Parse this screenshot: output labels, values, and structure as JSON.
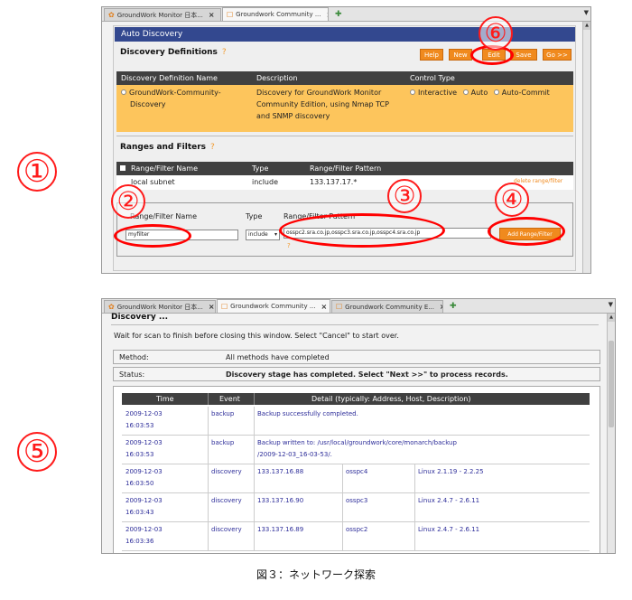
{
  "left_markers": [
    "①",
    "⑤"
  ],
  "shot1": {
    "tabs": [
      {
        "label": "GroundWork Monitor 日本...",
        "close": "×"
      },
      {
        "label": "Groundwork Community ...",
        "close": "×"
      }
    ],
    "new_tab": "✚",
    "tab_menu": "▼",
    "app_title": "Auto Discovery",
    "definitions": {
      "title": "Discovery Definitions",
      "help_mark": "?",
      "buttons": {
        "help": "Help",
        "new": "New",
        "edit": "Edit",
        "save": "Save",
        "go": "Go >>"
      },
      "headers": {
        "name": "Discovery Definition Name",
        "description": "Description",
        "control": "Control Type"
      },
      "row": {
        "name_line1": "GroundWork-Community-",
        "name_line2": "Discovery",
        "desc_line1": "Discovery for GroundWork Monitor",
        "desc_line2": "Community Edition, using Nmap TCP",
        "desc_line3": "and SNMP discovery",
        "control_options": [
          "Interactive",
          "Auto",
          "Auto-Commit"
        ]
      }
    },
    "ranges": {
      "title": "Ranges and Filters",
      "help_mark": "?",
      "headers": {
        "name": "Range/Filter Name",
        "type": "Type",
        "pattern": "Range/Filter Pattern"
      },
      "row": {
        "name": "local subnet",
        "type": "include",
        "pattern": "133.137.17.*",
        "delete": "delete range/filter"
      },
      "form": {
        "name_label": "Range/Filter Name",
        "type_label": "Type",
        "pattern_label": "Range/Filter Pattern",
        "name_value": "myfilter",
        "type_value": "include",
        "pattern_value": "osspc2.sra.co.jp,osspc3.sra.co.jp,osspc4.sra.co.jp",
        "add_button": "Add Range/Filter",
        "help_mark": "?"
      }
    },
    "annotations": [
      "⑥",
      "②",
      "③",
      "④"
    ]
  },
  "shot2": {
    "tabs": [
      {
        "label": "GroundWork Monitor 日本...",
        "close": "×"
      },
      {
        "label": "Groundwork Community ...",
        "close": "×"
      },
      {
        "label": "Groundwork Community E...",
        "close": "×"
      }
    ],
    "new_tab": "✚",
    "tab_menu": "▼",
    "section_title": "Discovery ...",
    "wait_text": "Wait for scan to finish before closing this window. Select \"Cancel\" to start over.",
    "method_label": "Method:",
    "method_value": "All methods have completed",
    "status_label": "Status:",
    "status_value": "Discovery stage has completed. Select \"Next >>\" to process records.",
    "log_headers": {
      "time": "Time",
      "event": "Event",
      "detail": "Detail (typically: Address, Host, Description)"
    },
    "log_rows": [
      {
        "date": "2009-12-03",
        "time": "16:03:53",
        "event": "backup",
        "detail": "Backup successfully completed.",
        "detail2": "",
        "host": "",
        "os": ""
      },
      {
        "date": "2009-12-03",
        "time": "16:03:53",
        "event": "backup",
        "detail": "Backup written to: /usr/local/groundwork/core/monarch/backup",
        "detail2": "/2009-12-03_16-03-53/.",
        "host": "",
        "os": ""
      },
      {
        "date": "2009-12-03",
        "time": "16:03:50",
        "event": "discovery",
        "detail": "133.137.16.88",
        "detail2": "",
        "host": "osspc4",
        "os": "Linux 2.1.19 - 2.2.25"
      },
      {
        "date": "2009-12-03",
        "time": "16:03:43",
        "event": "discovery",
        "detail": "133.137.16.90",
        "detail2": "",
        "host": "osspc3",
        "os": "Linux 2.4.7 - 2.6.11"
      },
      {
        "date": "2009-12-03",
        "time": "16:03:36",
        "event": "discovery",
        "detail": "133.137.16.89",
        "detail2": "",
        "host": "osspc2",
        "os": "Linux 2.4.7 - 2.6.11"
      }
    ]
  },
  "caption": "図３：ネットワーク探索",
  "colors": {
    "header_blue": "#33488f",
    "orange": "#f08a1e",
    "highlight": "#fdc55c",
    "annotation_red": "#ff0000",
    "link": "#2e2e9a"
  }
}
